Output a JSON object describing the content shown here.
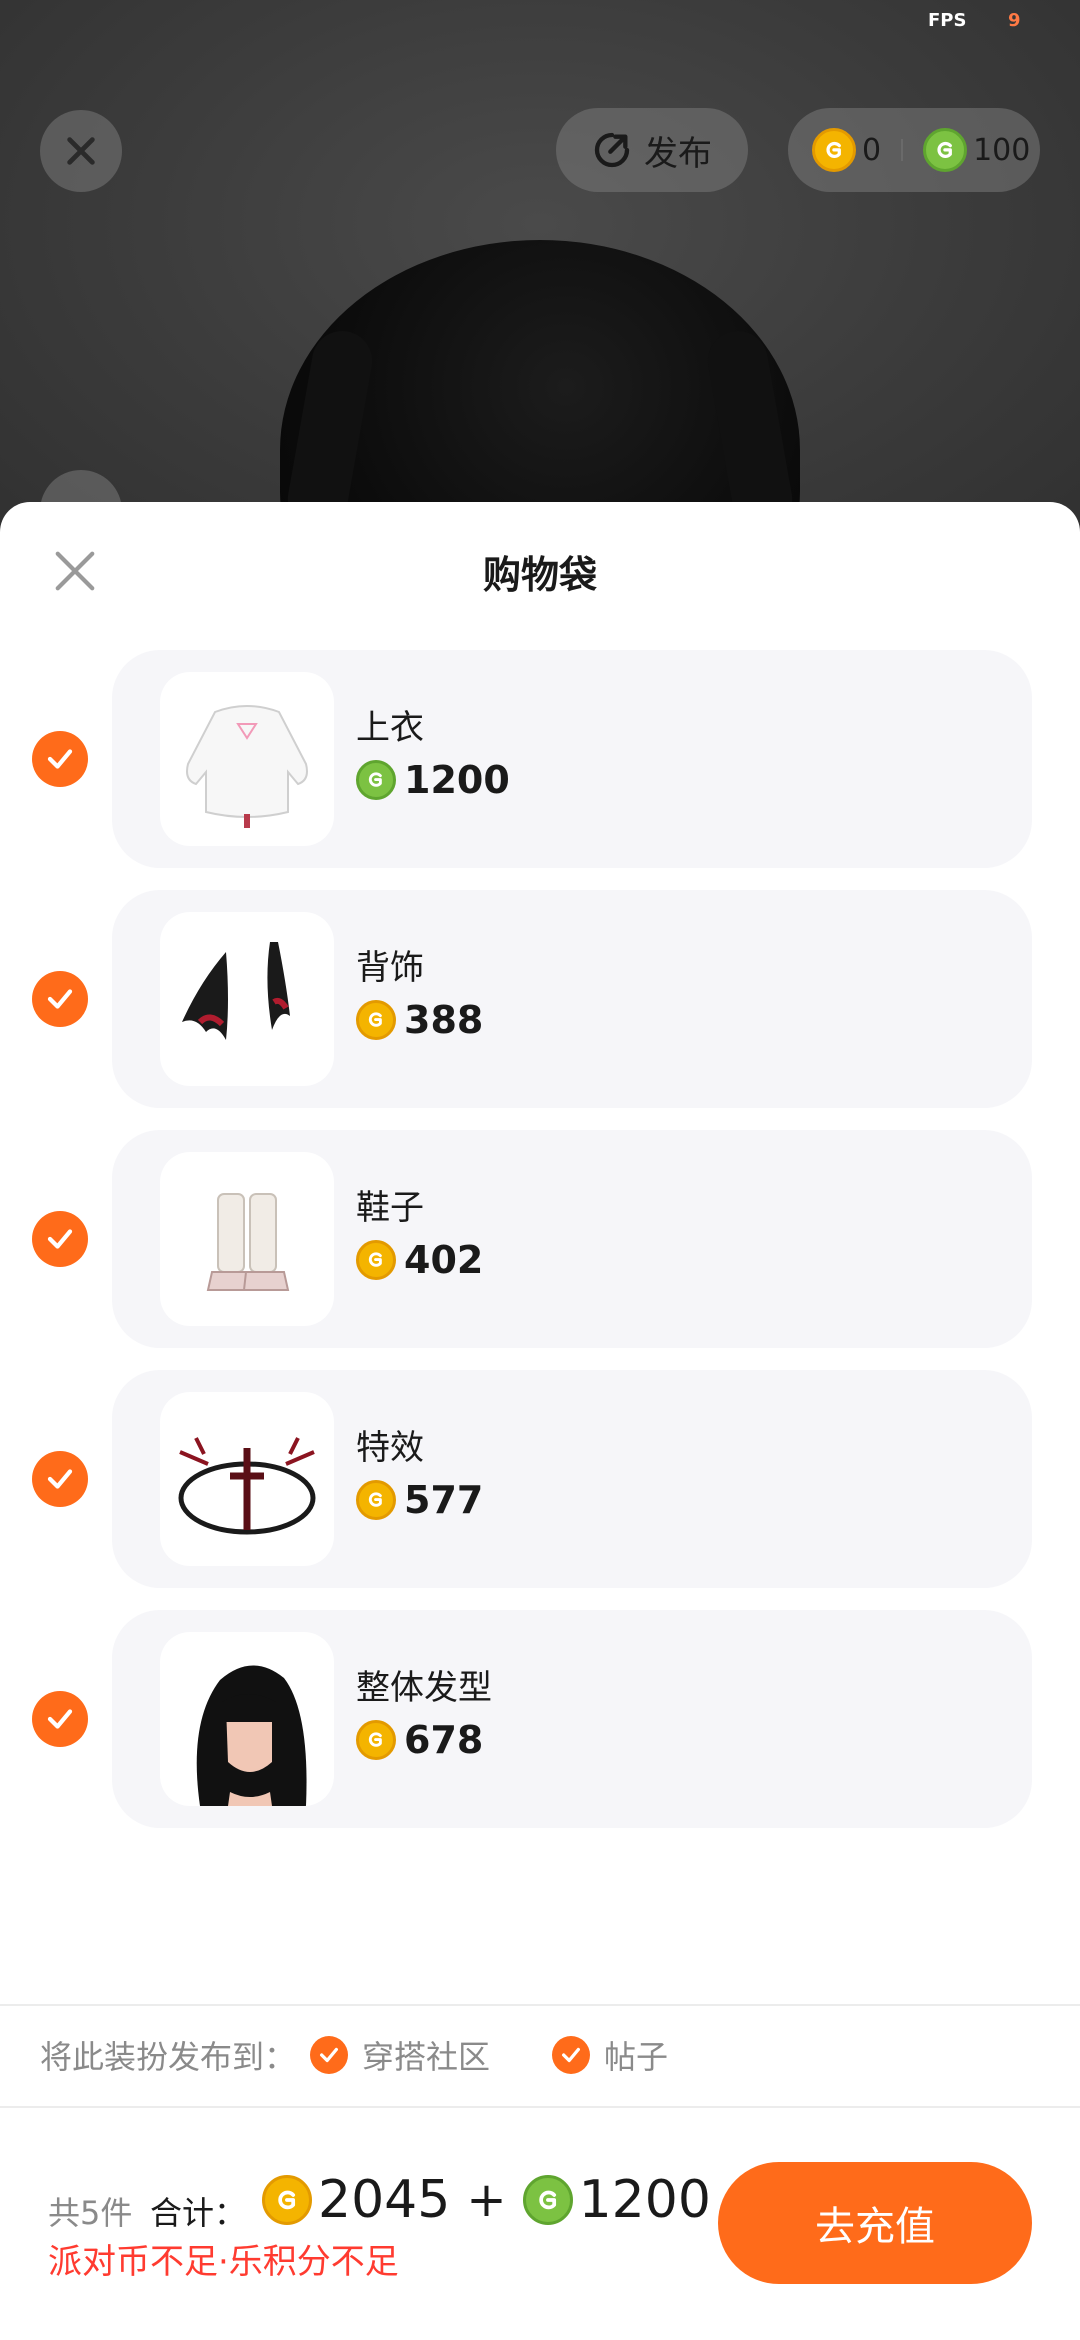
{
  "status": {
    "fps_label": "FPS",
    "fps_value": "9"
  },
  "topbar": {
    "publish_label": "发布",
    "gold_balance": "0",
    "green_balance": "100",
    "close_icon": "close-icon",
    "publish_icon": "publish-icon"
  },
  "sheet": {
    "title": "购物袋",
    "items": [
      {
        "name": "上衣",
        "price": "1200",
        "currency": "green",
        "thumbnail": "white-hoodie",
        "checked": true
      },
      {
        "name": "背饰",
        "price": "388",
        "currency": "gold",
        "thumbnail": "bat-wings",
        "checked": true
      },
      {
        "name": "鞋子",
        "price": "402",
        "currency": "gold",
        "thumbnail": "boots",
        "checked": true
      },
      {
        "name": "特效",
        "price": "577",
        "currency": "gold",
        "thumbnail": "magic-circle",
        "checked": true
      },
      {
        "name": "整体发型",
        "price": "678",
        "currency": "gold",
        "thumbnail": "black-hair",
        "checked": true
      }
    ]
  },
  "publish_to": {
    "label": "将此装扮发布到：",
    "options": [
      {
        "label": "穿搭社区",
        "checked": true
      },
      {
        "label": "帖子",
        "checked": true
      }
    ]
  },
  "footer": {
    "count": "共5件",
    "total_label": "合计：",
    "gold_total": "2045",
    "plus": "+",
    "green_total": "1200",
    "warning": "派对币不足·乐积分不足",
    "recharge_button": "去充值"
  },
  "colors": {
    "accent": "#ff6b1a",
    "warning": "#ff3b30",
    "gold_coin": "#f4b400",
    "green_coin": "#7cc242"
  }
}
